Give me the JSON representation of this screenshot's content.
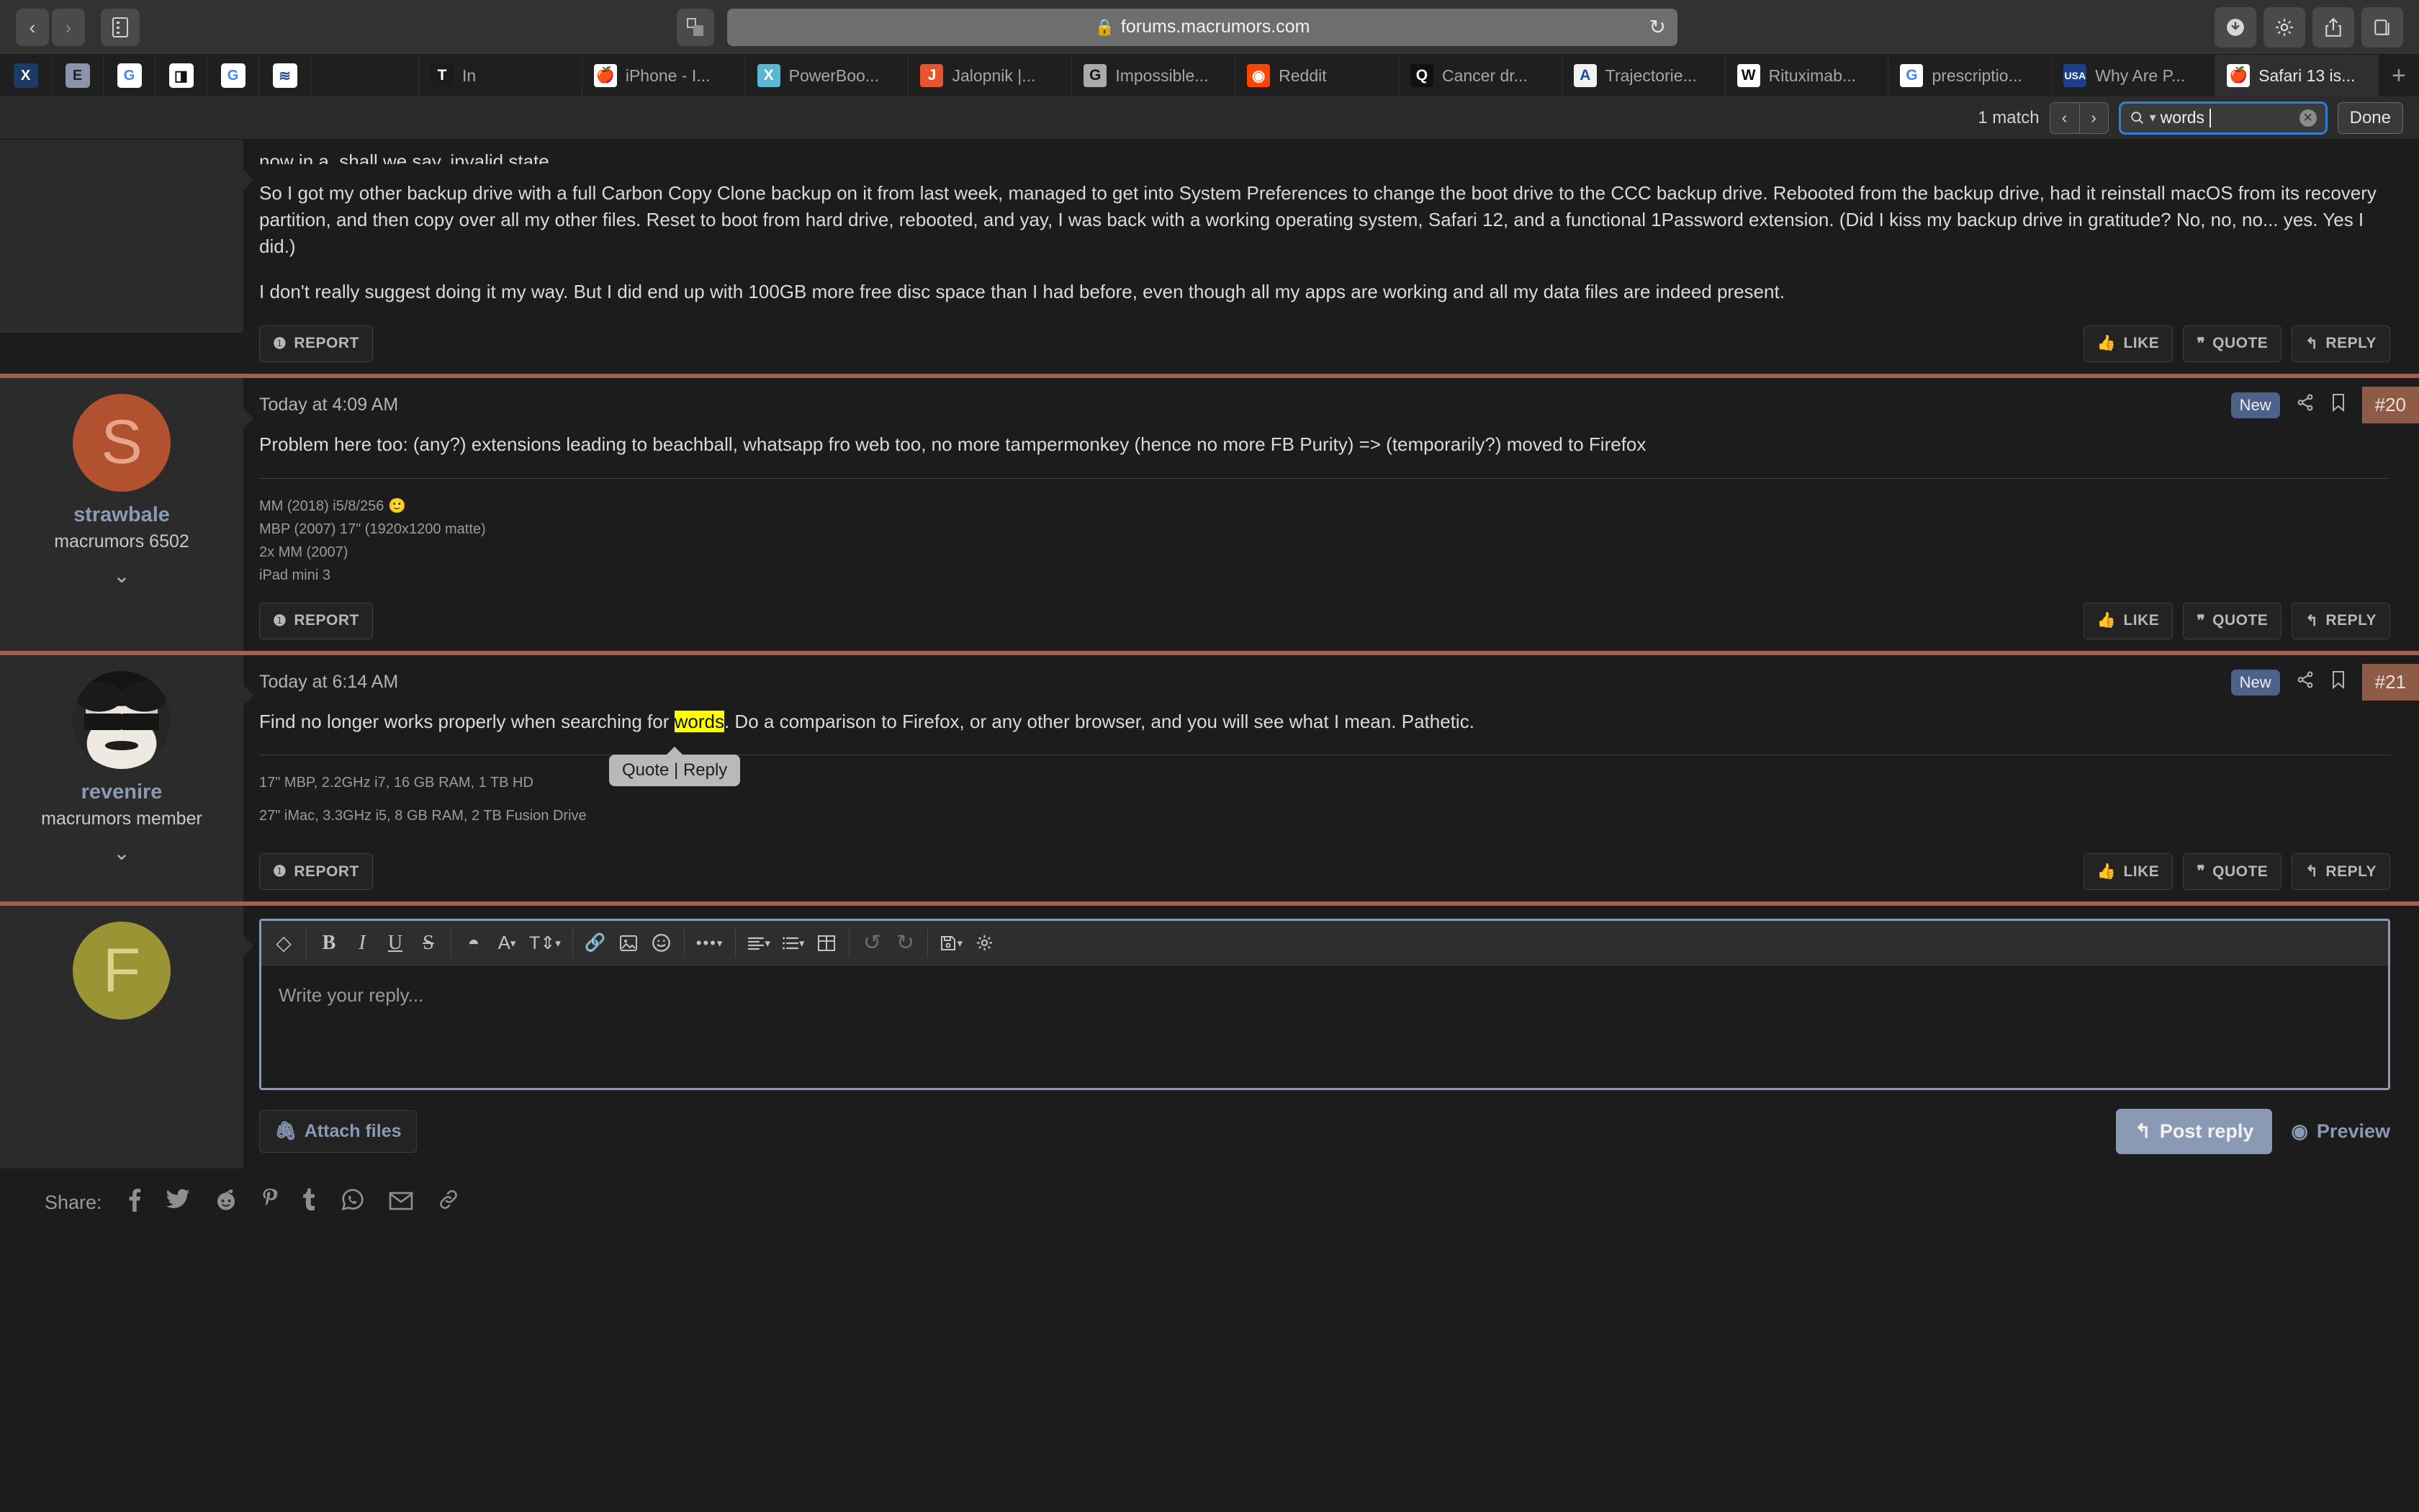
{
  "browser": {
    "url": "forums.macrumors.com",
    "lock_icon": "lock-icon",
    "back_label": "‹",
    "forward_label": "›",
    "reload_label": "↻",
    "toolbar_buttons": [
      {
        "name": "downloads-button",
        "glyph": "⬇"
      },
      {
        "name": "extensions-button",
        "glyph": "⚙"
      },
      {
        "name": "share-button",
        "glyph": "⬆"
      },
      {
        "name": "tab-overview-button",
        "glyph": "❐"
      }
    ],
    "favorites": [
      {
        "name": "favorite-1",
        "letter": "X",
        "bg": "#1b3a66",
        "color": "#ffffff"
      },
      {
        "name": "favorite-2",
        "letter": "E",
        "bg": "#8d93a8",
        "color": "#20242e"
      },
      {
        "name": "favorite-3",
        "letter": "G",
        "bg": "#ffffff",
        "color": "#4285f4"
      },
      {
        "name": "favorite-4",
        "letter": "◨",
        "bg": "#ffffff",
        "color": "#111111"
      },
      {
        "name": "favorite-5",
        "letter": "G",
        "bg": "#ffffff",
        "color": "#4285f4"
      },
      {
        "name": "favorite-6",
        "letter": "≋",
        "bg": "#ffffff",
        "color": "#1c4f8c"
      }
    ],
    "tabs": [
      {
        "label": "In",
        "icon_letter": "T",
        "icon_bg": "#1b1b1b",
        "icon_color": "#ffffff",
        "active": false
      },
      {
        "label": "iPhone - I...",
        "icon_letter": "🍎",
        "icon_bg": "#ffffff",
        "icon_color": "#d9482f",
        "active": false
      },
      {
        "label": "PowerBoo...",
        "icon_letter": "X",
        "icon_bg": "#5bb8d4",
        "icon_color": "#ffffff",
        "active": false
      },
      {
        "label": "Jalopnik |...",
        "icon_letter": "J",
        "icon_bg": "#e8552d",
        "icon_color": "#ffffff",
        "active": false
      },
      {
        "label": "Impossible...",
        "icon_letter": "G",
        "icon_bg": "#aaaaaa",
        "icon_color": "#111111",
        "active": false
      },
      {
        "label": "Reddit",
        "icon_letter": "◉",
        "icon_bg": "#ff4500",
        "icon_color": "#ffffff",
        "active": false
      },
      {
        "label": "Cancer dr...",
        "icon_letter": "Q",
        "icon_bg": "#111111",
        "icon_color": "#ffffff",
        "active": false
      },
      {
        "label": "Trajectorie...",
        "icon_letter": "A",
        "icon_bg": "#f2f2f2",
        "icon_color": "#1b4f9c",
        "active": false
      },
      {
        "label": "Rituximab...",
        "icon_letter": "W",
        "icon_bg": "#ffffff",
        "icon_color": "#111111",
        "active": false
      },
      {
        "label": "prescriptio...",
        "icon_letter": "G",
        "icon_bg": "#ffffff",
        "icon_color": "#4285f4",
        "active": false
      },
      {
        "label": "Why Are P...",
        "icon_letter": "USA",
        "icon_bg": "#1d3f8a",
        "icon_color": "#ffffff",
        "active": false
      },
      {
        "label": "Safari 13 is...",
        "icon_letter": "🍎",
        "icon_bg": "#ffffff",
        "icon_color": "#d9482f",
        "active": true
      }
    ],
    "new_tab_label": "+"
  },
  "findbar": {
    "match_count": "1 match",
    "prev_label": "‹",
    "next_label": "›",
    "search_icon": "magnifier-icon",
    "query": "words",
    "clear_label": "✕",
    "done_label": "Done",
    "accent_color": "#2f7fd8"
  },
  "posts": [
    {
      "name": "post-19-partial",
      "date": "",
      "body_lead": "now in a, shall we say, invalid state.",
      "paragraphs": [
        "So I got my other backup drive with a full Carbon Copy Clone backup on it from last week, managed to get into System Preferences to change the boot drive to the CCC backup drive. Rebooted from the backup drive, had it reinstall macOS from its recovery partition, and then copy over all my other files. Reset to boot from hard drive, rebooted, and yay, I was back with a working operating system, Safari 12, and a functional 1Password extension. (Did I kiss my backup drive in gratitude? No, no, no... yes. Yes I did.)",
        "I don't really suggest doing it my way. But I did end up with 100GB more free disc space than I had before, even though all my apps are working and all my data files are indeed present."
      ],
      "report_label": "REPORT",
      "like_label": "LIKE",
      "quote_label": "QUOTE",
      "reply_label": "REPLY"
    },
    {
      "name": "post-20",
      "username": "strawbale",
      "user_title": "macrumors 6502",
      "avatar_letter": "S",
      "avatar_bg": "#b1512f",
      "avatar_color": "#e8a38a",
      "date": "Today at 4:09 AM",
      "new_badge": "New",
      "share_icon": "share-icon",
      "bookmark_icon": "bookmark-icon",
      "post_number": "#20",
      "body": "Problem here too: (any?) extensions leading to beachball, whatsapp fro web too, no more tampermonkey (hence no more FB Purity) => (temporarily?) moved to Firefox",
      "signature": [
        "MM (2018) i5/8/256 🙂",
        "MBP (2007) 17\" (1920x1200 matte)",
        "2x MM (2007)",
        "iPad mini 3"
      ],
      "report_label": "REPORT",
      "like_label": "LIKE",
      "quote_label": "QUOTE",
      "reply_label": "REPLY"
    },
    {
      "name": "post-21",
      "username": "revenire",
      "user_title": "macrumors member",
      "avatar_letter": "",
      "date": "Today at 6:14 AM",
      "new_badge": "New",
      "share_icon": "share-icon",
      "bookmark_icon": "bookmark-icon",
      "post_number": "#21",
      "body_before": "Find no longer works properly when searching for ",
      "body_highlight": "words",
      "body_after": ". Do a comparison to Firefox, or any other browser, and you will see what I mean. Pathetic.",
      "tooltip": "Quote | Reply",
      "signature": [
        "17\" MBP, 2.2GHz i7, 16 GB RAM, 1 TB HD",
        "27\" iMac, 3.3GHz i5, 8 GB RAM, 2 TB Fusion Drive"
      ],
      "report_label": "REPORT",
      "like_label": "LIKE",
      "quote_label": "QUOTE",
      "reply_label": "REPLY"
    }
  ],
  "editor": {
    "avatar_letter": "F",
    "avatar_bg": "#9a9434",
    "avatar_color": "#d7d38a",
    "placeholder": "Write your reply...",
    "toolbar": [
      {
        "name": "remove-formatting-icon",
        "glyph": "◇"
      },
      {
        "name": "bold-icon",
        "glyph": "B"
      },
      {
        "name": "italic-icon",
        "glyph": "I"
      },
      {
        "name": "underline-icon",
        "glyph": "U"
      },
      {
        "name": "strikethrough-icon",
        "glyph": "S"
      },
      {
        "name": "text-color-icon",
        "glyph": "◓"
      },
      {
        "name": "font-family-icon",
        "glyph": "A▾"
      },
      {
        "name": "font-size-icon",
        "glyph": "T⇕▾"
      },
      {
        "name": "insert-link-icon",
        "glyph": "🔗"
      },
      {
        "name": "insert-image-icon",
        "glyph": "🖼"
      },
      {
        "name": "insert-emoji-icon",
        "glyph": "☺"
      },
      {
        "name": "more-options-icon",
        "glyph": "•••▾"
      },
      {
        "name": "text-align-icon",
        "glyph": "≡▾"
      },
      {
        "name": "list-icon",
        "glyph": "☰▾"
      },
      {
        "name": "insert-table-icon",
        "glyph": "▦"
      },
      {
        "name": "undo-icon",
        "glyph": "↺"
      },
      {
        "name": "redo-icon",
        "glyph": "↻"
      },
      {
        "name": "draft-icon",
        "glyph": "💾▾"
      },
      {
        "name": "editor-settings-icon",
        "glyph": "⚙"
      }
    ],
    "attach_label": "Attach files",
    "attach_icon": "paperclip-icon",
    "post_reply_label": "Post reply",
    "post_reply_icon": "reply-arrow-icon",
    "preview_label": "Preview",
    "preview_icon": "eye-icon",
    "accent_color": "#8a9ab5"
  },
  "share": {
    "label": "Share:",
    "items": [
      {
        "name": "share-facebook-icon",
        "glyph": "f"
      },
      {
        "name": "share-twitter-icon",
        "glyph": "🐦"
      },
      {
        "name": "share-reddit-icon",
        "glyph": "◉"
      },
      {
        "name": "share-pinterest-icon",
        "glyph": "P"
      },
      {
        "name": "share-tumblr-icon",
        "glyph": "t"
      },
      {
        "name": "share-whatsapp-icon",
        "glyph": "✆"
      },
      {
        "name": "share-email-icon",
        "glyph": "✉"
      },
      {
        "name": "share-link-icon",
        "glyph": "🔗"
      }
    ]
  }
}
